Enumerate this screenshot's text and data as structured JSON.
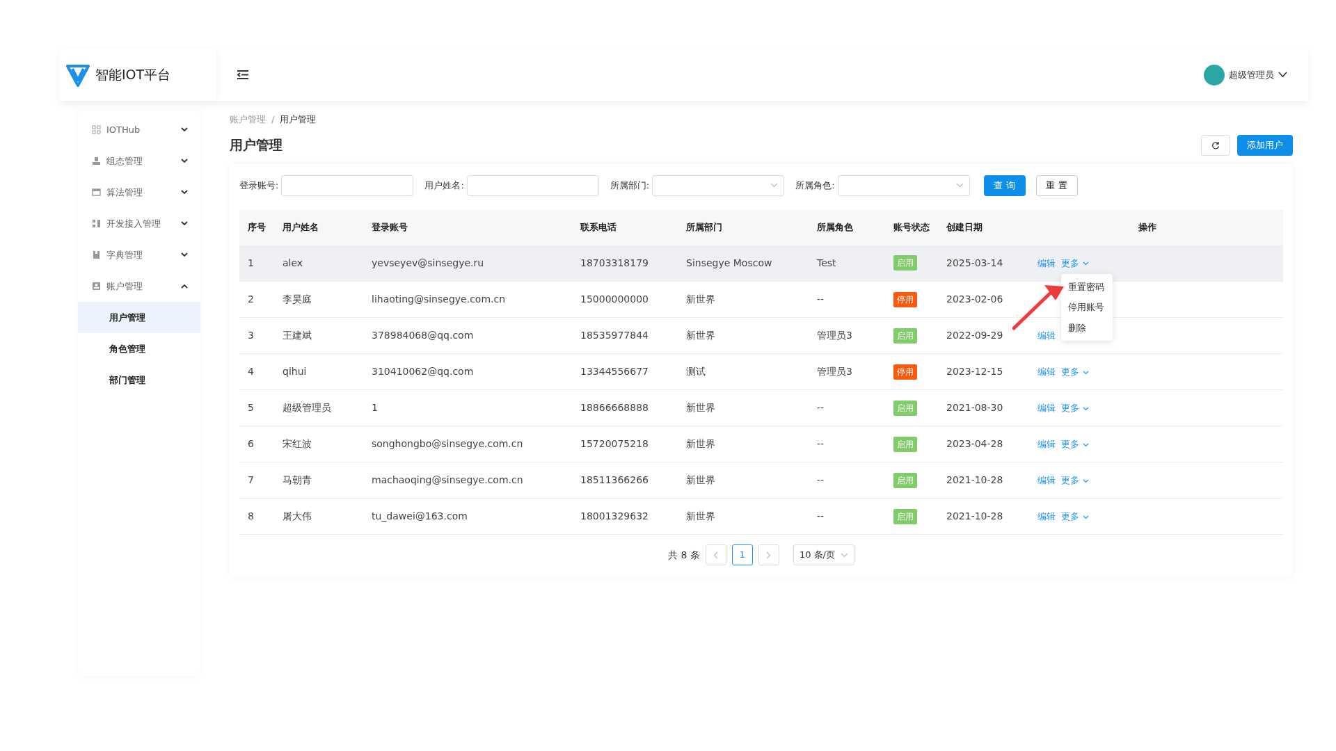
{
  "header": {
    "logo_text": "智能IOT平台",
    "user": "超级管理员"
  },
  "sidebar": {
    "items": [
      {
        "label": "IOTHub",
        "expanded": false
      },
      {
        "label": "组态管理",
        "expanded": false
      },
      {
        "label": "算法管理",
        "expanded": false
      },
      {
        "label": "开发接入管理",
        "expanded": false
      },
      {
        "label": "字典管理",
        "expanded": false
      },
      {
        "label": "账户管理",
        "expanded": true,
        "children": [
          {
            "label": "用户管理",
            "selected": true
          },
          {
            "label": "角色管理",
            "selected": false
          },
          {
            "label": "部门管理",
            "selected": false
          }
        ]
      }
    ]
  },
  "breadcrumb": [
    {
      "label": "账户管理",
      "current": false
    },
    {
      "label": "用户管理",
      "current": true
    }
  ],
  "breadcrumb_separator": "/",
  "page_title": "用户管理",
  "add_button": "添加用户",
  "filters": [
    {
      "label": "登录账号:",
      "kind": "text"
    },
    {
      "label": "用户姓名:",
      "kind": "text"
    },
    {
      "label": "所属部门:",
      "kind": "select"
    },
    {
      "label": "所属角色:",
      "kind": "select"
    }
  ],
  "query_button": "查 询",
  "reset_button": "重 置",
  "table": {
    "columns": [
      "序号",
      "用户姓名",
      "登录账号",
      "联系电话",
      "所属部门",
      "所属角色",
      "账号状态",
      "创建日期",
      "操作"
    ],
    "rows": [
      {
        "cells": [
          "1",
          "alex",
          "yevseyev@sinsegye.ru",
          "18703318179",
          "Sinsegye Moscow",
          "Test"
        ],
        "status": {
          "label": "启用",
          "enabled": true
        },
        "date": "2025-03-14",
        "actions": [
          {
            "label": "编辑",
            "kind": "link"
          },
          {
            "label": "更多",
            "kind": "dropdown"
          }
        ],
        "hovered": true
      },
      {
        "cells": [
          "2",
          "李昊庭",
          "lihaoting@sinsegye.com.cn",
          "15000000000",
          "新世界",
          "--"
        ],
        "status": {
          "label": "停用",
          "enabled": false
        },
        "date": "2023-02-06",
        "hovered": false
      },
      {
        "cells": [
          "3",
          "王建斌",
          "378984068@qq.com",
          "18535977844",
          "新世界",
          "管理员3"
        ],
        "status": {
          "label": "启用",
          "enabled": true
        },
        "date": "2022-09-29",
        "actions": [
          {
            "label": "编辑",
            "kind": "link"
          }
        ],
        "hovered": false
      },
      {
        "cells": [
          "4",
          "qihui",
          "310410062@qq.com",
          "13344556677",
          "测试",
          "管理员3"
        ],
        "status": {
          "label": "停用",
          "enabled": false
        },
        "date": "2023-12-15",
        "actions": [
          {
            "label": "编辑",
            "kind": "link"
          },
          {
            "label": "更多",
            "kind": "dropdown"
          }
        ],
        "hovered": false
      },
      {
        "cells": [
          "5",
          "超级管理员",
          "1",
          "18866668888",
          "新世界",
          "--"
        ],
        "status": {
          "label": "启用",
          "enabled": true
        },
        "date": "2021-08-30",
        "actions": [
          {
            "label": "编辑",
            "kind": "link"
          },
          {
            "label": "更多",
            "kind": "dropdown"
          }
        ],
        "hovered": false
      },
      {
        "cells": [
          "6",
          "宋红波",
          "songhongbo@sinsegye.com.cn",
          "15720075218",
          "新世界",
          "--"
        ],
        "status": {
          "label": "启用",
          "enabled": true
        },
        "date": "2023-04-28",
        "actions": [
          {
            "label": "编辑",
            "kind": "link"
          },
          {
            "label": "更多",
            "kind": "dropdown"
          }
        ],
        "hovered": false
      },
      {
        "cells": [
          "7",
          "马朝青",
          "machaoqing@sinsegye.com.cn",
          "18511366266",
          "新世界",
          "--"
        ],
        "status": {
          "label": "启用",
          "enabled": true
        },
        "date": "2021-10-28",
        "actions": [
          {
            "label": "编辑",
            "kind": "link"
          },
          {
            "label": "更多",
            "kind": "dropdown"
          }
        ],
        "hovered": false
      },
      {
        "cells": [
          "8",
          "屠大伟",
          "tu_dawei@163.com",
          "18001329632",
          "新世界",
          "--"
        ],
        "status": {
          "label": "启用",
          "enabled": true
        },
        "date": "2021-10-28",
        "actions": [
          {
            "label": "编辑",
            "kind": "link"
          },
          {
            "label": "更多",
            "kind": "dropdown"
          }
        ],
        "hovered": false
      }
    ]
  },
  "dropdown_menu": [
    "重置密码",
    "停用账号",
    "删除"
  ],
  "pagination": {
    "total": "共 8 条",
    "pages": [
      {
        "label": "1",
        "selected": true
      }
    ],
    "page_size": "10 条/页"
  }
}
